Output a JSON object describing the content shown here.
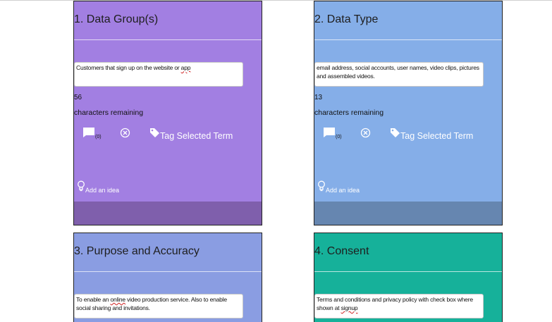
{
  "colors": {
    "card1_bg": "#a27fe2",
    "card1_footer": "#7f5fac",
    "card2_bg": "#85aee8",
    "card2_footer": "#6686b0",
    "card3_bg": "#8a9de2",
    "card4_bg": "#16b19a"
  },
  "cards": [
    {
      "title": "1. Data Group(s)",
      "text_parts": [
        "Customers that sign up on the website or ",
        "app",
        ""
      ],
      "count": "56",
      "remaining_label": "characters remaining",
      "comment_count": "(0)",
      "tag_label": "Tag Selected Term",
      "idea_label": "Add an idea"
    },
    {
      "title": "2. Data Type",
      "text": "email address, social accounts, user names, video clips, pictures and assembled videos.",
      "count": "13",
      "remaining_label": "characters remaining",
      "comment_count": "(0)",
      "tag_label": "Tag Selected Term",
      "idea_label": "Add an idea"
    },
    {
      "title": "3. Purpose and Accuracy",
      "text_parts": [
        "To enable an ",
        "online",
        " video production service. Also to enable social sharing and invitations."
      ]
    },
    {
      "title": "4. Consent",
      "text_parts": [
        "Terms and conditions and privacy policy with check box where shown at ",
        "signup",
        ""
      ]
    }
  ],
  "icons": {
    "comment": "comment-icon",
    "clear": "close-circle-icon",
    "tag": "tag-icon",
    "idea": "lightbulb-icon"
  }
}
